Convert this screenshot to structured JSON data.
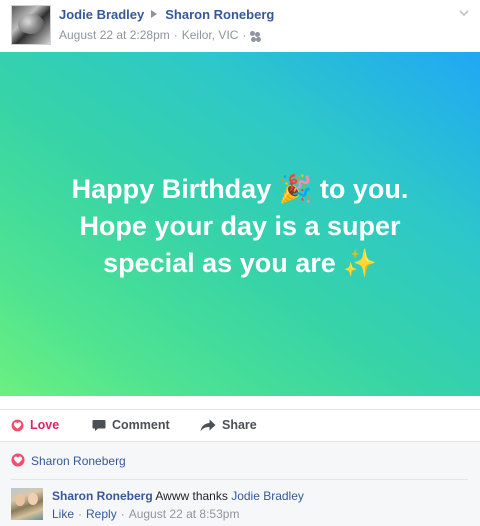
{
  "header": {
    "author": "Jodie Bradley",
    "recipient": "Sharon Roneberg",
    "date": "August 22 at 2:28pm",
    "location": "Keilor, VIC",
    "separator": "·"
  },
  "post": {
    "text": "Happy Birthday 🎉 to you. Hope your day is a super special as you are ✨",
    "background_colors": [
      "#6cf07f",
      "#36d3a8",
      "#20a8f5"
    ]
  },
  "actions": {
    "love": "Love",
    "comment": "Comment",
    "share": "Share"
  },
  "reactions": {
    "who": "Sharon Roneberg"
  },
  "comment": {
    "author": "Sharon Roneberg",
    "text": "Awww thanks",
    "mention": "Jodie Bradley",
    "like": "Like",
    "reply": "Reply",
    "timestamp": "August 22 at 8:53pm",
    "separator": "·"
  },
  "icons": {
    "header_arrow": "triangle-right-icon",
    "audience": "friends-icon",
    "menu": "chevron-down-icon",
    "love": "heart-icon",
    "comment": "speech-bubble-icon",
    "share": "share-arrow-icon"
  },
  "colors": {
    "link": "#365899",
    "love": "#e0245e",
    "meta": "#90949c"
  }
}
